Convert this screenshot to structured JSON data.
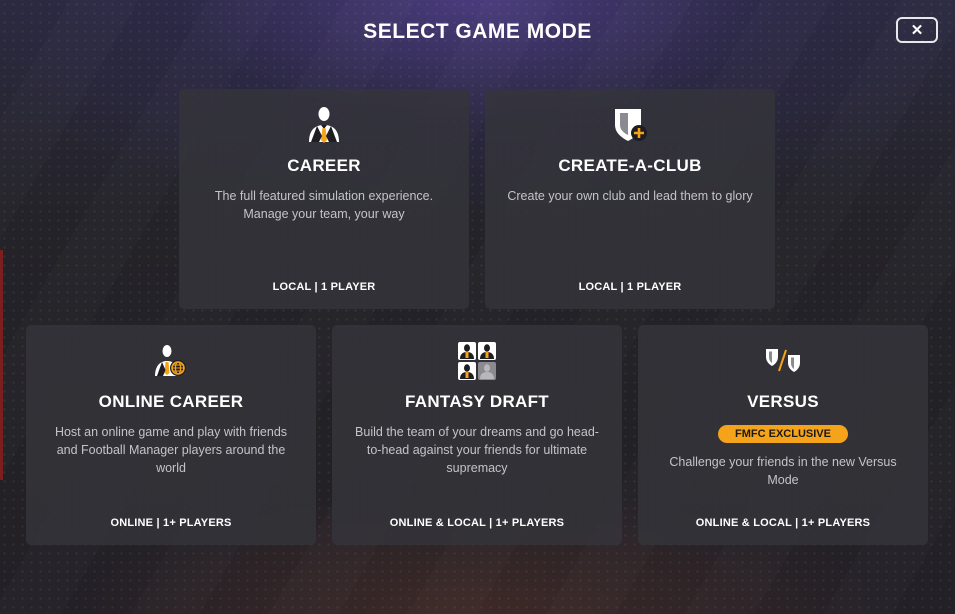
{
  "dialog": {
    "title": "SELECT GAME MODE",
    "close_label": "✕"
  },
  "modes": [
    {
      "title": "CAREER",
      "icon": "manager-icon",
      "description": "The full featured simulation experience. Manage your team, your way",
      "meta": "LOCAL | 1 PLAYER"
    },
    {
      "title": "CREATE-A-CLUB",
      "icon": "club-badge-plus-icon",
      "description": "Create your own club and lead them to glory",
      "meta": "LOCAL | 1 PLAYER"
    },
    {
      "title": "ONLINE CAREER",
      "icon": "online-manager-icon",
      "description": "Host an online game and play with friends and Football Manager players around the world",
      "meta": "ONLINE | 1+ PLAYERS"
    },
    {
      "title": "FANTASY DRAFT",
      "icon": "player-grid-icon",
      "description": "Build the team of your dreams and go head-to-head against your friends for ultimate supremacy",
      "meta": "ONLINE & LOCAL | 1+ PLAYERS"
    },
    {
      "title": "VERSUS",
      "icon": "versus-shields-icon",
      "badge": "FMFC EXCLUSIVE",
      "description": "Challenge your friends in the new Versus Mode",
      "meta": "ONLINE & LOCAL | 1+ PLAYERS"
    }
  ],
  "colors": {
    "accent": "#f5a31a",
    "card_bg": "#34343a",
    "text_primary": "#ffffff",
    "text_secondary": "#c4c4c8"
  }
}
